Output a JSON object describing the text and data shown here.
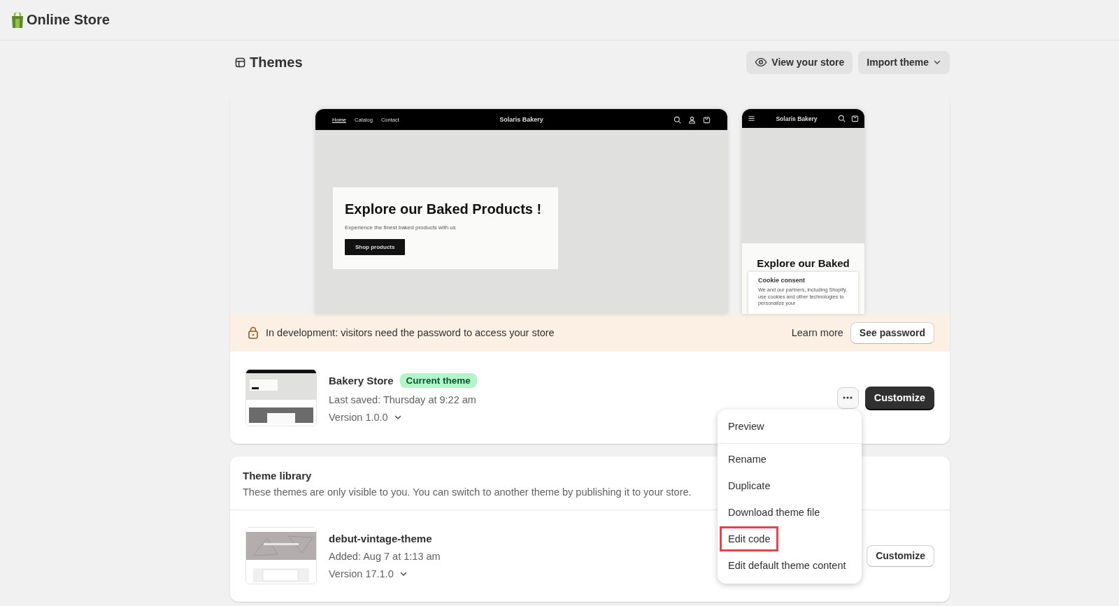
{
  "app_bar": {
    "title": "Online Store"
  },
  "page": {
    "title": "Themes",
    "actions": [
      {
        "label": "View your store",
        "kind": "view"
      },
      {
        "label": "Import theme",
        "kind": "dropdown"
      }
    ]
  },
  "preview": {
    "desktop": {
      "nav": [
        {
          "label": "Home",
          "selected": true
        },
        {
          "label": "Catalog",
          "selected": false
        },
        {
          "label": "Contact",
          "selected": false
        }
      ],
      "store_name": "Solaris Bakery",
      "hero_title": "Explore our Baked Products !",
      "hero_subtitle": "Experience the finest baked products with us",
      "hero_button": "Shop products"
    },
    "mobile": {
      "store_name": "Solaris Bakery",
      "hero_title": "Explore our Baked",
      "cookie_title": "Cookie consent",
      "cookie_text": "We and our partners, including Shopify, use cookies and other technologies to personalize your"
    }
  },
  "banner": {
    "text": "In development: visitors need the password to access your store",
    "link": "Learn more",
    "button": "See password"
  },
  "current_theme": {
    "name": "Bakery Store",
    "badge": "Current theme",
    "saved": "Last saved: Thursday at 9:22 am",
    "version": "Version 1.0.0",
    "button": "Customize"
  },
  "menu": {
    "sections": [
      {
        "items": [
          {
            "label": "Preview",
            "highlighted": false
          }
        ]
      },
      {
        "items": [
          {
            "label": "Rename",
            "highlighted": false
          },
          {
            "label": "Duplicate",
            "highlighted": false
          },
          {
            "label": "Download theme file",
            "highlighted": false
          },
          {
            "label": "Edit code",
            "highlighted": true
          },
          {
            "label": "Edit default theme content",
            "highlighted": false
          }
        ]
      }
    ]
  },
  "library": {
    "title": "Theme library",
    "description": "These themes are only visible to you. You can switch to another theme by publishing it to your store.",
    "themes": [
      {
        "name": "debut-vintage-theme",
        "added": "Added: Aug 7 at 1:13 am",
        "version": "Version 17.1.0",
        "button": "Customize"
      }
    ]
  }
}
